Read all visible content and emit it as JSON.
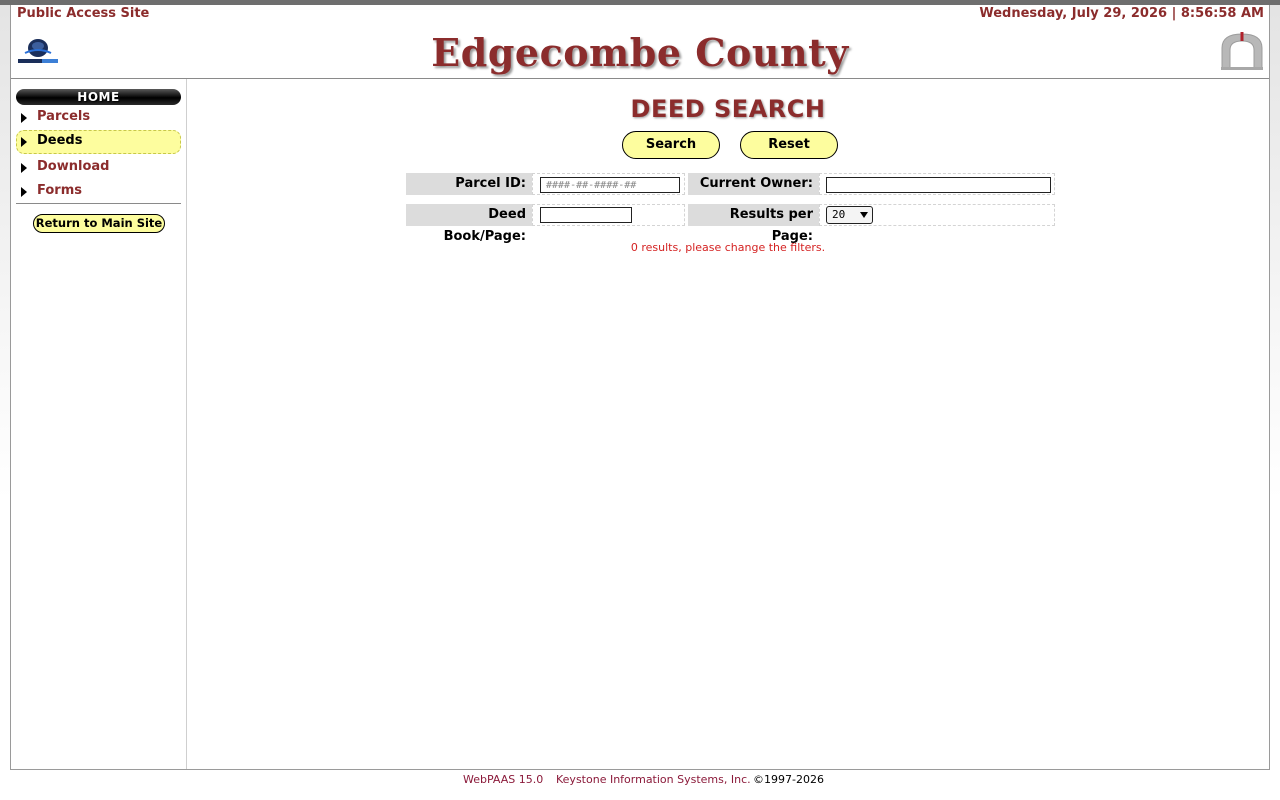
{
  "header": {
    "site_label": "Public Access Site",
    "datetime": "Wednesday, July 29, 2026 | 8:56:58 AM",
    "county_name": "Edgecombe County",
    "left_logo": "county-seal-logo",
    "right_logo": "arch-logo"
  },
  "sidebar": {
    "home_label": "HOME",
    "items": [
      {
        "label": "Parcels",
        "active": false
      },
      {
        "label": "Deeds",
        "active": true
      },
      {
        "label": "Download",
        "active": false
      },
      {
        "label": "Forms",
        "active": false
      }
    ],
    "return_label": "Return to Main Site"
  },
  "main": {
    "title": "DEED SEARCH",
    "search_label": "Search",
    "reset_label": "Reset",
    "fields": {
      "parcel_id_label": "Parcel ID:",
      "parcel_id_placeholder": "####-##-####-##",
      "parcel_id_value": "",
      "owner_label": "Current Owner:",
      "owner_value": "",
      "deed_book_label": "Deed Book/Page:",
      "deed_book_value": "",
      "results_per_page_label": "Results per Page:",
      "results_per_page_value": "20"
    },
    "results_message": "0 results, please change the filters."
  },
  "footer": {
    "version": "WebPAAS 15.0",
    "company": "Keystone Information Systems, Inc.",
    "copyright": "©1997-2026"
  },
  "colors": {
    "brand": "#8b2c2c",
    "highlight": "#fdfd9e",
    "label_bg": "#dcdcdc",
    "error": "#d42222"
  }
}
